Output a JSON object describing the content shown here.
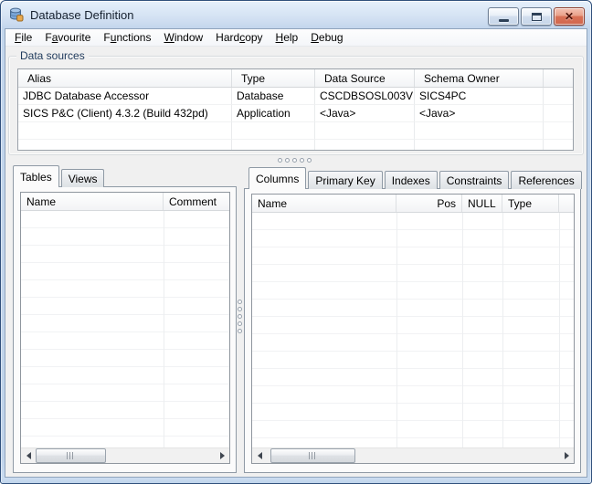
{
  "window": {
    "title": "Database Definition",
    "icon": "database-icon",
    "buttons": [
      {
        "name": "minimize-button",
        "icon": "minimize-icon"
      },
      {
        "name": "maximize-button",
        "icon": "maximize-icon"
      },
      {
        "name": "close-button",
        "icon": "close-icon",
        "glyph": "✕"
      }
    ]
  },
  "menu": {
    "items": [
      {
        "label": "File",
        "pre": "",
        "u": "F",
        "post": "ile"
      },
      {
        "label": "Favourite",
        "pre": "F",
        "u": "a",
        "post": "vourite"
      },
      {
        "label": "Functions",
        "pre": "F",
        "u": "u",
        "post": "nctions"
      },
      {
        "label": "Window",
        "pre": "",
        "u": "W",
        "post": "indow"
      },
      {
        "label": "Hardcopy",
        "pre": "Hard",
        "u": "c",
        "post": "opy"
      },
      {
        "label": "Help",
        "pre": "",
        "u": "H",
        "post": "elp"
      },
      {
        "label": "Debug",
        "pre": "",
        "u": "D",
        "post": "ebug"
      }
    ]
  },
  "data_sources": {
    "group_label": "Data sources",
    "columns": [
      "Alias",
      "Type",
      "Data Source",
      "Schema Owner"
    ],
    "rows": [
      [
        "JDBC Database Accessor",
        "Database",
        "CSCDBSOSL003V",
        "SICS4PC"
      ],
      [
        "SICS P&C (Client) 4.3.2  (Build 432pd)",
        "Application",
        "<Java>",
        "<Java>"
      ]
    ]
  },
  "left_panel": {
    "tabs": [
      "Tables",
      "Views"
    ],
    "active_tab": "Tables",
    "columns": [
      "Name",
      "Comment"
    ]
  },
  "right_panel": {
    "tabs": [
      "Columns",
      "Primary Key",
      "Indexes",
      "Constraints",
      "References"
    ],
    "active_tab": "Columns",
    "columns": [
      "Name",
      "Pos",
      "NULL",
      "Type"
    ]
  },
  "colors": {
    "titlebar_top": "#e6f0fb",
    "titlebar_bottom": "#c3d6ec",
    "window_border": "#30507c",
    "close_button": "#d0664c",
    "client_bg": "#f0f0f0",
    "groupbox_label": "#1e395b"
  }
}
